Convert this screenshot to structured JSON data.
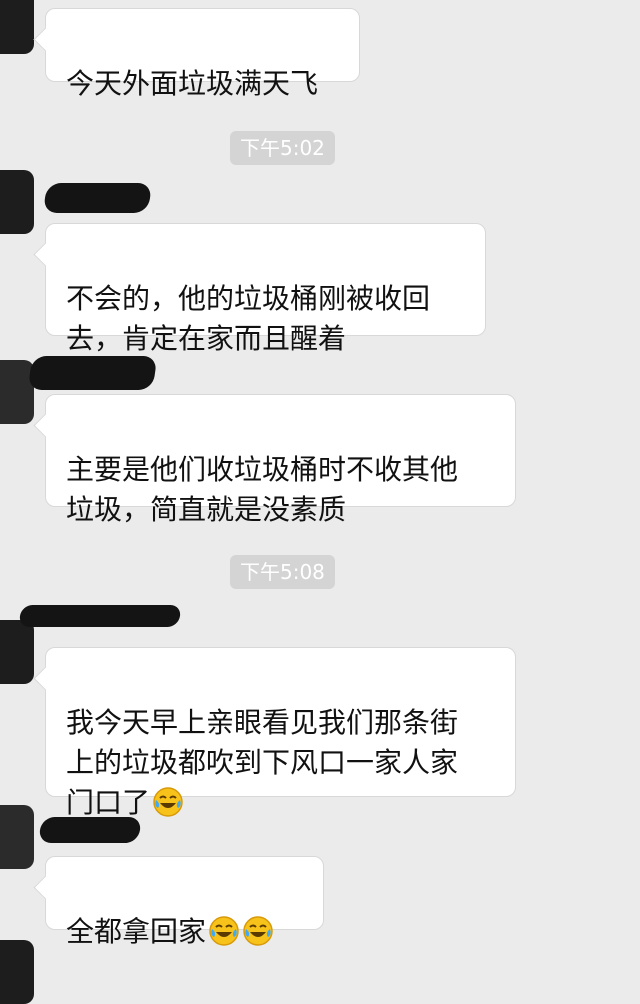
{
  "chat": {
    "messages": [
      {
        "text": "今天外面垃圾满天飞"
      },
      {
        "text": "不会的，他的垃圾桶刚被收回\n去，肯定在家而且醒着"
      },
      {
        "text": "主要是他们收垃圾桶时不收其他\n垃圾，简直就是没素质"
      },
      {
        "text": "我今天早上亲眼看见我们那条街\n上的垃圾都吹到下风口一家人家\n门口了",
        "emoji": [
          "laughing-crying-emoji"
        ]
      },
      {
        "text": "全都拿回家",
        "emoji": [
          "laughing-crying-emoji",
          "laughing-crying-emoji"
        ]
      }
    ],
    "timestamps": [
      "下午5:02",
      "下午5:08"
    ]
  },
  "colors": {
    "background": "#ebebeb",
    "bubble": "#ffffff",
    "timestamp_pill": "#d4d4d4"
  }
}
